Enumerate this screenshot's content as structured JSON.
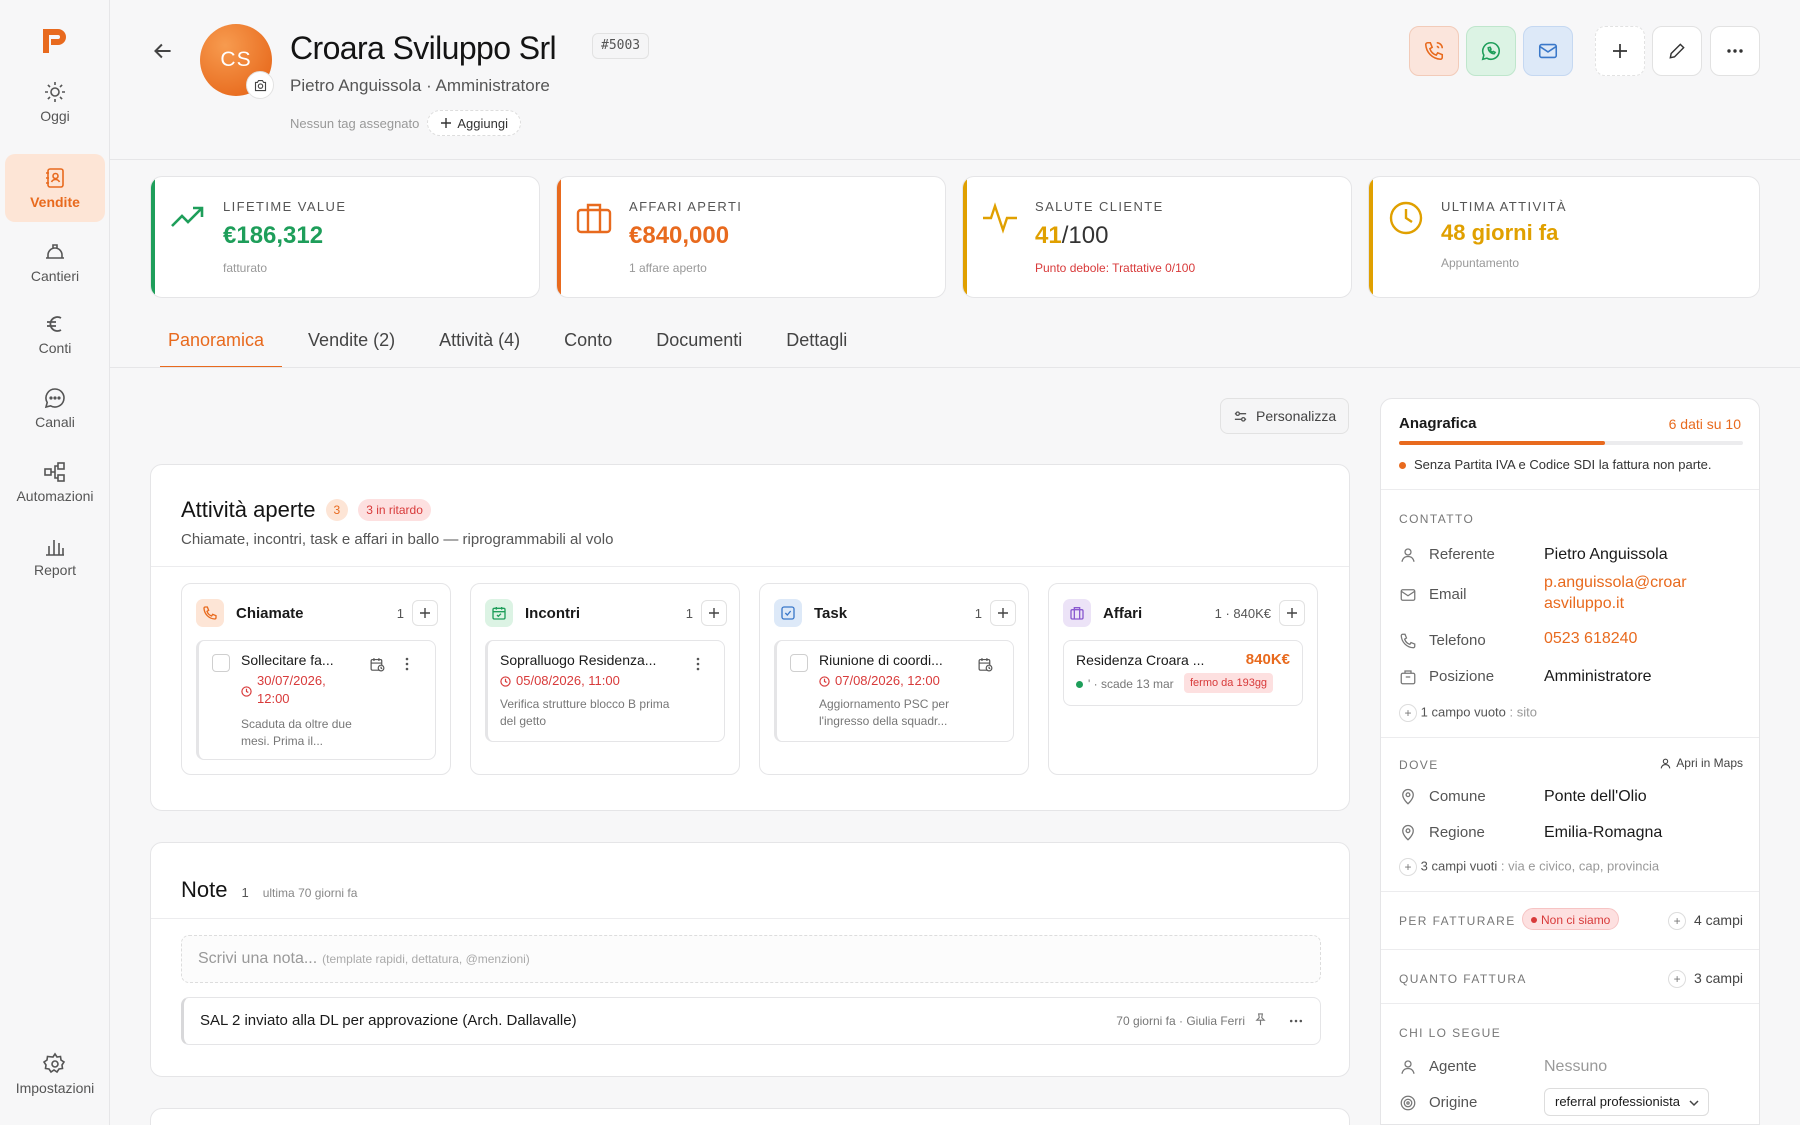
{
  "colors": {
    "accent": "#e86a1e",
    "green": "#1e9e5a",
    "red": "#d83a3a",
    "yellow": "#e0a000"
  },
  "sidebar": {
    "logo": "P",
    "items": [
      {
        "label": "Oggi",
        "icon": "sun-icon"
      },
      {
        "label": "Vendite",
        "icon": "contact-book-icon",
        "active": true
      },
      {
        "label": "Cantieri",
        "icon": "helmet-icon"
      },
      {
        "label": "Conti",
        "icon": "euro-icon"
      },
      {
        "label": "Canali",
        "icon": "chat-icon"
      },
      {
        "label": "Automazioni",
        "icon": "flow-icon"
      },
      {
        "label": "Report",
        "icon": "bar-chart-icon"
      }
    ],
    "settings": "Impostazioni"
  },
  "header": {
    "initials": "CS",
    "name": "Croara Sviluppo Srl",
    "id": "#5003",
    "subtitle": "Pietro Anguissola · Amministratore",
    "no_tags": "Nessun tag assegnato",
    "add_tag": "Aggiungi"
  },
  "kpis": [
    {
      "label": "LIFETIME VALUE",
      "value": "€186,312",
      "sub": "fatturato",
      "color": "#1e9e5a",
      "icon": "trend-up-icon"
    },
    {
      "label": "AFFARI APERTI",
      "value": "€840,000",
      "sub": "1 affare aperto",
      "color": "#e86a1e",
      "icon": "briefcase-icon"
    },
    {
      "label": "SALUTE CLIENTE",
      "value_main": "41",
      "value_rest": "/100",
      "sub": "Punto debole: Trattative 0/100",
      "color": "#e0a000",
      "icon": "pulse-icon"
    },
    {
      "label": "ULTIMA ATTIVITÀ",
      "value": "48 giorni fa",
      "sub": "Appuntamento",
      "color": "#e0a000",
      "icon": "clock-icon"
    }
  ],
  "tabs": [
    {
      "label": "Panoramica",
      "count": "",
      "active": true
    },
    {
      "label": "Vendite",
      "count": "(2)"
    },
    {
      "label": "Attività",
      "count": "(4)"
    },
    {
      "label": "Conto",
      "count": ""
    },
    {
      "label": "Documenti",
      "count": ""
    },
    {
      "label": "Dettagli",
      "count": ""
    }
  ],
  "customize": "Personalizza",
  "activities": {
    "title": "Attività aperte",
    "count": "3",
    "late": "3 in ritardo",
    "subtitle": "Chiamate, incontri, task e affari in ballo — riprogrammabili al volo",
    "columns": [
      {
        "title": "Chiamate",
        "count": "1",
        "icon": "phone-icon",
        "item": {
          "title": "Sollecitare fa...",
          "date": "30/07/2026, 12:00",
          "desc": "Scaduta da oltre due mesi. Prima il..."
        }
      },
      {
        "title": "Incontri",
        "count": "1",
        "icon": "calendar-icon",
        "item": {
          "title": "Sopralluogo Residenza...",
          "date": "05/08/2026, 11:00",
          "desc": "Verifica strutture blocco B prima del getto"
        }
      },
      {
        "title": "Task",
        "count": "1",
        "icon": "checkbox-icon",
        "item": {
          "title": "Riunione di coordi...",
          "date": "07/08/2026, 12:00",
          "desc": "Aggiornamento PSC per l'ingresso della squadr..."
        }
      },
      {
        "title": "Affari",
        "count": "1 · 840K€",
        "icon": "briefcase-icon",
        "item": {
          "title": "Residenza Croara ...",
          "value": "840K€",
          "meta": "' · scade 13 mar",
          "badge": "fermo da 193gg"
        }
      }
    ]
  },
  "notes": {
    "title": "Note",
    "count": "1",
    "meta": "ultima 70 giorni fa",
    "placeholder": "Scrivi una nota...",
    "placeholder_hint": "(template rapidi, dettatura, @menzioni)",
    "items": [
      {
        "text": "SAL 2 inviato alla DL per approvazione (Arch. Dallavalle)",
        "meta": "70 giorni fa · Giulia Ferri"
      }
    ]
  },
  "anagrafica": {
    "title": "Anagrafica",
    "progress_label": "6 dati su 10",
    "progress": 0.6,
    "warning": "Senza Partita IVA e Codice SDI la fattura non parte.",
    "contatto": {
      "label": "CONTATTO",
      "rows": [
        {
          "label": "Referente",
          "value": "Pietro Anguissola",
          "icon": "user-icon"
        },
        {
          "label": "Email",
          "value": "p.anguissola@croarasviluppo.it",
          "icon": "mail-icon"
        },
        {
          "label": "Telefono",
          "value": "0523 618240",
          "icon": "phone-icon"
        },
        {
          "label": "Posizione",
          "value": "Amministratore",
          "icon": "building-icon"
        }
      ],
      "empty": "1 campo vuoto",
      "empty_hint": ": sito"
    },
    "dove": {
      "label": "DOVE",
      "maps": "Apri in Maps",
      "rows": [
        {
          "label": "Comune",
          "value": "Ponte dell'Olio",
          "icon": "pin-icon"
        },
        {
          "label": "Regione",
          "value": "Emilia-Romagna",
          "icon": "pin-icon"
        }
      ],
      "empty": "3 campi vuoti",
      "empty_hint": ": via e civico, cap, provincia"
    },
    "fatturare": {
      "label": "PER FATTURARE",
      "badge": "Non ci siamo",
      "fields": "4 campi"
    },
    "quanto": {
      "label": "QUANTO FATTURA",
      "fields": "3 campi"
    },
    "segue": {
      "label": "CHI LO SEGUE",
      "agente_label": "Agente",
      "agente_value": "Nessuno",
      "origine_label": "Origine",
      "origine_value": "referral professionista"
    }
  }
}
